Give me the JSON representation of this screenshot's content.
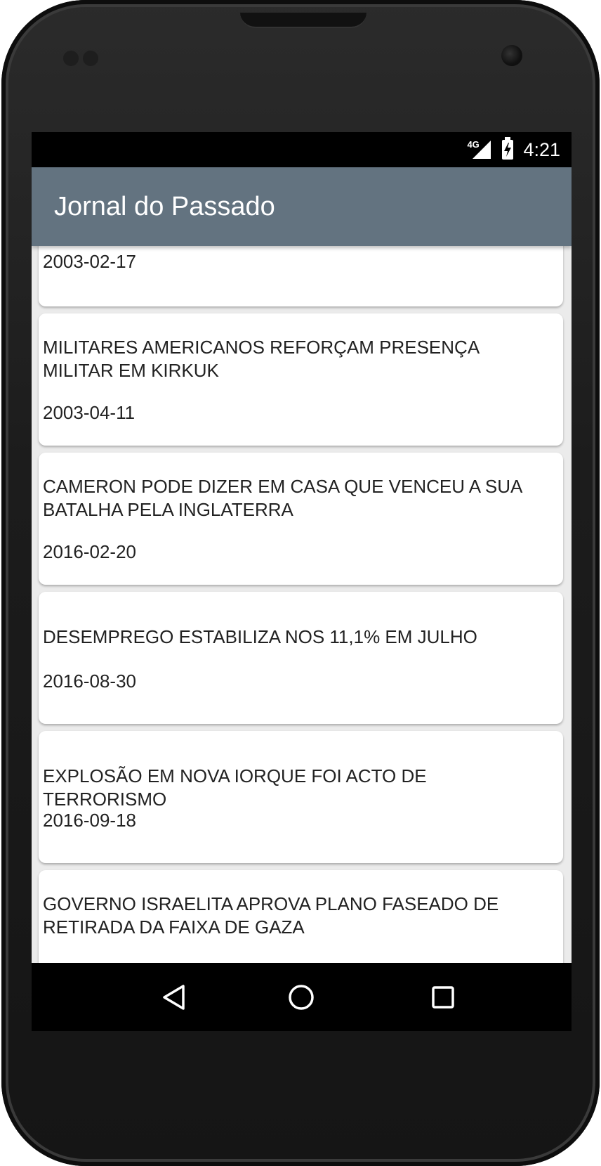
{
  "status_bar": {
    "network": "4G",
    "time": "4:21"
  },
  "app_bar": {
    "title": "Jornal do Passado"
  },
  "articles": [
    {
      "headline": "",
      "date": "2003-02-17"
    },
    {
      "headline": "MILITARES AMERICANOS REFORÇAM PRESENÇA MILITAR EM KIRKUK",
      "date": "2003-04-11"
    },
    {
      "headline": "CAMERON PODE DIZER EM CASA QUE VENCEU A SUA BATALHA PELA INGLATERRA",
      "date": "2016-02-20"
    },
    {
      "headline": "DESEMPREGO ESTABILIZA NOS 11,1% EM JULHO",
      "date": "2016-08-30"
    },
    {
      "headline": "EXPLOSÃO EM NOVA IORQUE FOI ACTO DE TERRORISMO",
      "date": "2016-09-18"
    },
    {
      "headline": "GOVERNO ISRAELITA APROVA PLANO FASEADO DE RETIRADA DA FAIXA DE GAZA",
      "date": ""
    }
  ],
  "nav_bar": {
    "back_icon": "back-triangle-icon",
    "home_icon": "home-circle-icon",
    "recents_icon": "recents-square-icon"
  }
}
